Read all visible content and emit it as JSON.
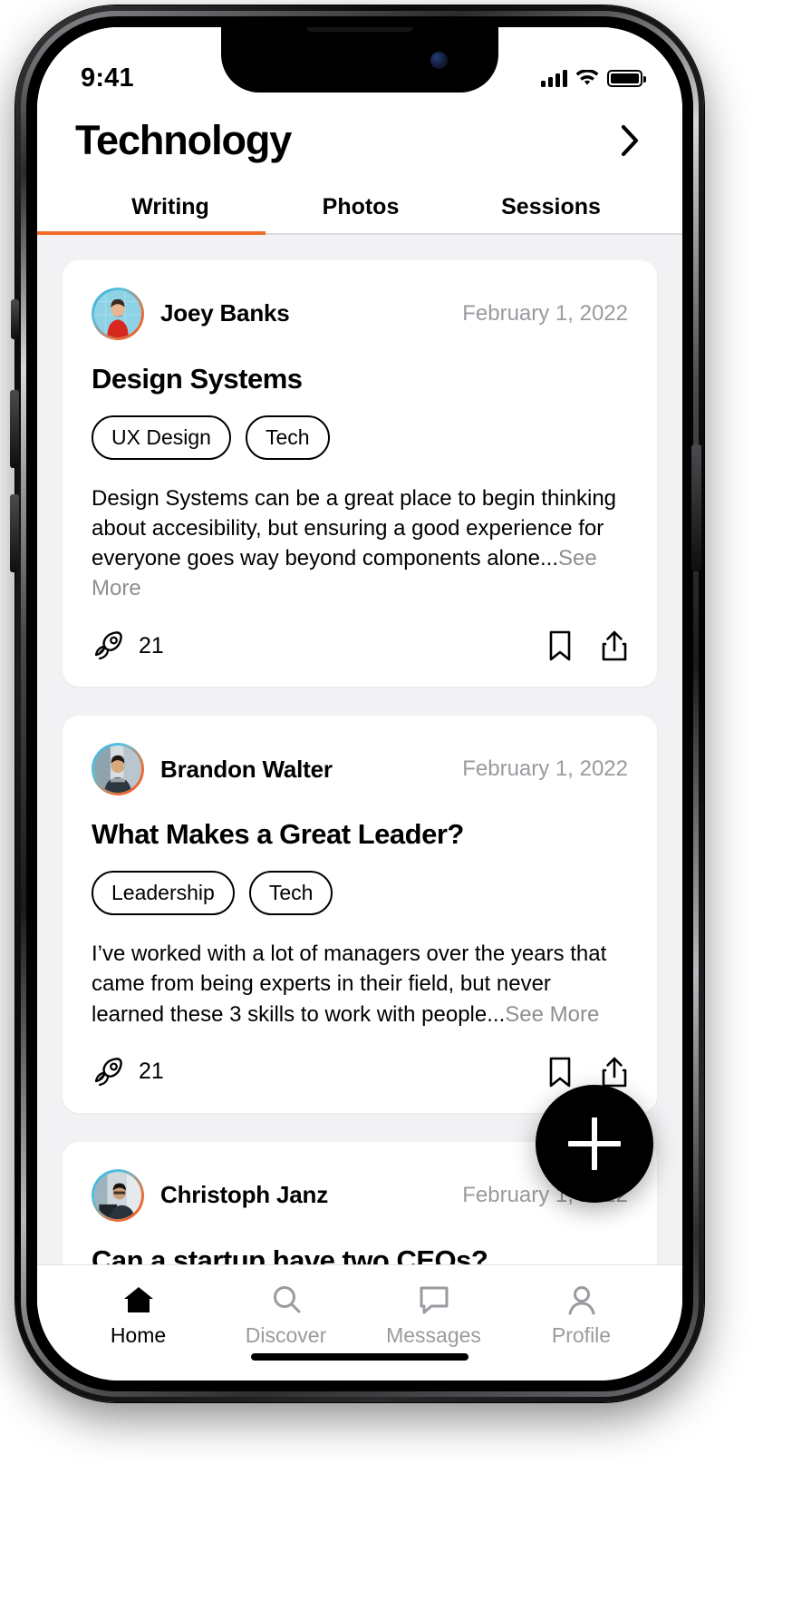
{
  "status_bar": {
    "time": "9:41",
    "cellular_icon": "signal-bars-icon",
    "wifi_icon": "wifi-icon",
    "battery_icon": "battery-full-icon"
  },
  "header": {
    "title": "Technology",
    "chevron_icon": "chevron-right-icon",
    "accent_color": "#F26B29"
  },
  "tabs": [
    {
      "label": "Writing",
      "active": true
    },
    {
      "label": "Photos",
      "active": false
    },
    {
      "label": "Sessions",
      "active": false
    }
  ],
  "feed": {
    "cards": [
      {
        "author": "Joey Banks",
        "date": "February 1, 2022",
        "title": "Design Systems",
        "tags": [
          "UX Design",
          "Tech"
        ],
        "excerpt": "Design Systems can be a great place to begin thinking about accesibility, but ensuring a good experience for everyone goes way beyond components alone...",
        "see_more": "See More",
        "boost_count": "21",
        "boost_icon": "rocket-icon",
        "bookmark_icon": "bookmark-icon",
        "share_icon": "share-icon"
      },
      {
        "author": "Brandon Walter",
        "date": "February 1, 2022",
        "title": "What Makes a Great Leader?",
        "tags": [
          "Leadership",
          "Tech"
        ],
        "excerpt": "I’ve worked with a lot of managers over the years that came from being experts in their field, but never learned these 3 skills to work with people...",
        "see_more": "See More",
        "boost_count": "21",
        "boost_icon": "rocket-icon",
        "bookmark_icon": "bookmark-icon",
        "share_icon": "share-icon"
      },
      {
        "author": "Christoph Janz",
        "date": "February 1, 2022",
        "title": "Can a startup have two CEOs?",
        "tags": [],
        "excerpt": "",
        "see_more": "",
        "boost_count": "",
        "boost_icon": "rocket-icon",
        "bookmark_icon": "bookmark-icon",
        "share_icon": "share-icon"
      }
    ]
  },
  "fab": {
    "icon": "plus-icon",
    "label": ""
  },
  "bottom_nav": [
    {
      "label": "Home",
      "icon": "home-icon",
      "active": true
    },
    {
      "label": "Discover",
      "icon": "search-icon",
      "active": false
    },
    {
      "label": "Messages",
      "icon": "message-icon",
      "active": false
    },
    {
      "label": "Profile",
      "icon": "person-icon",
      "active": false
    }
  ]
}
